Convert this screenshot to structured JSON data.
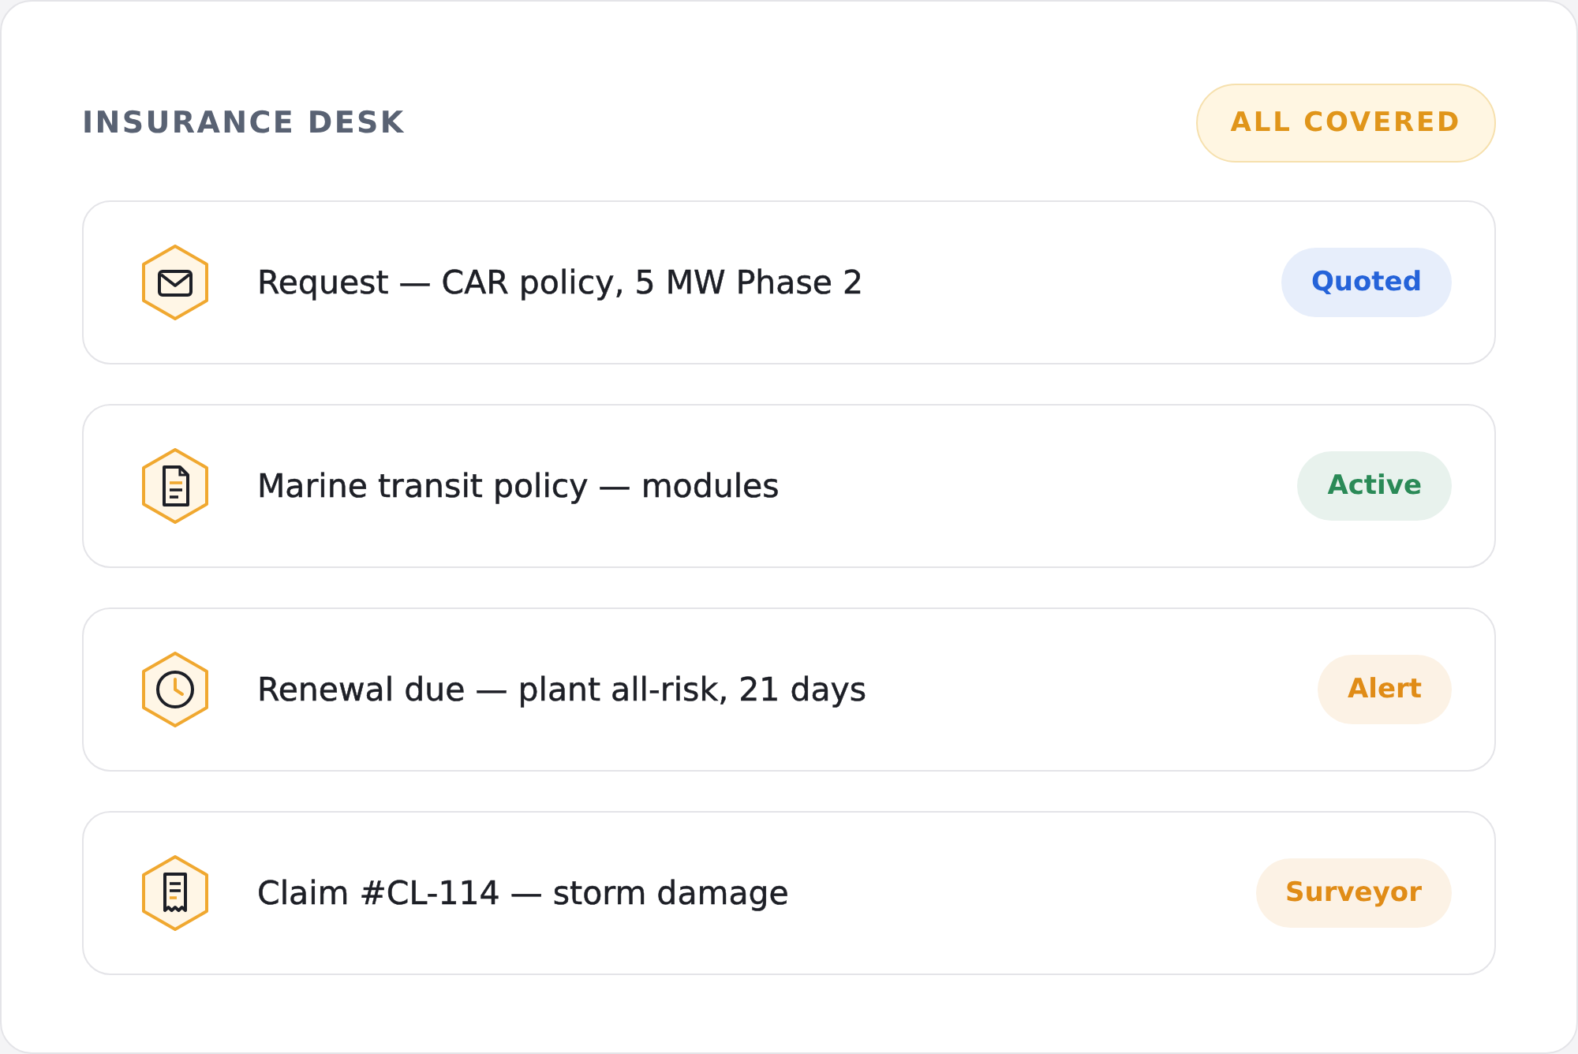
{
  "header": {
    "title": "INSURANCE DESK",
    "coverage_badge": {
      "label": "ALL COVERED"
    }
  },
  "items": [
    {
      "kind": "envelope",
      "title": "Request — CAR policy, 5 MW Phase 2",
      "status": {
        "label": "Quoted",
        "color": "#2563d9"
      }
    },
    {
      "kind": "document",
      "title": "Marine transit policy — modules",
      "status": {
        "label": "Active",
        "color": "#2a8a57"
      }
    },
    {
      "kind": "clock",
      "title": "Renewal due — plant all-risk, 21 days",
      "status": {
        "label": "Alert",
        "color": "#e08c17"
      }
    },
    {
      "kind": "receipt",
      "title": "Claim #CL-114 — storm damage",
      "status": {
        "label": "Surveyor",
        "color": "#e08c17"
      }
    }
  ]
}
